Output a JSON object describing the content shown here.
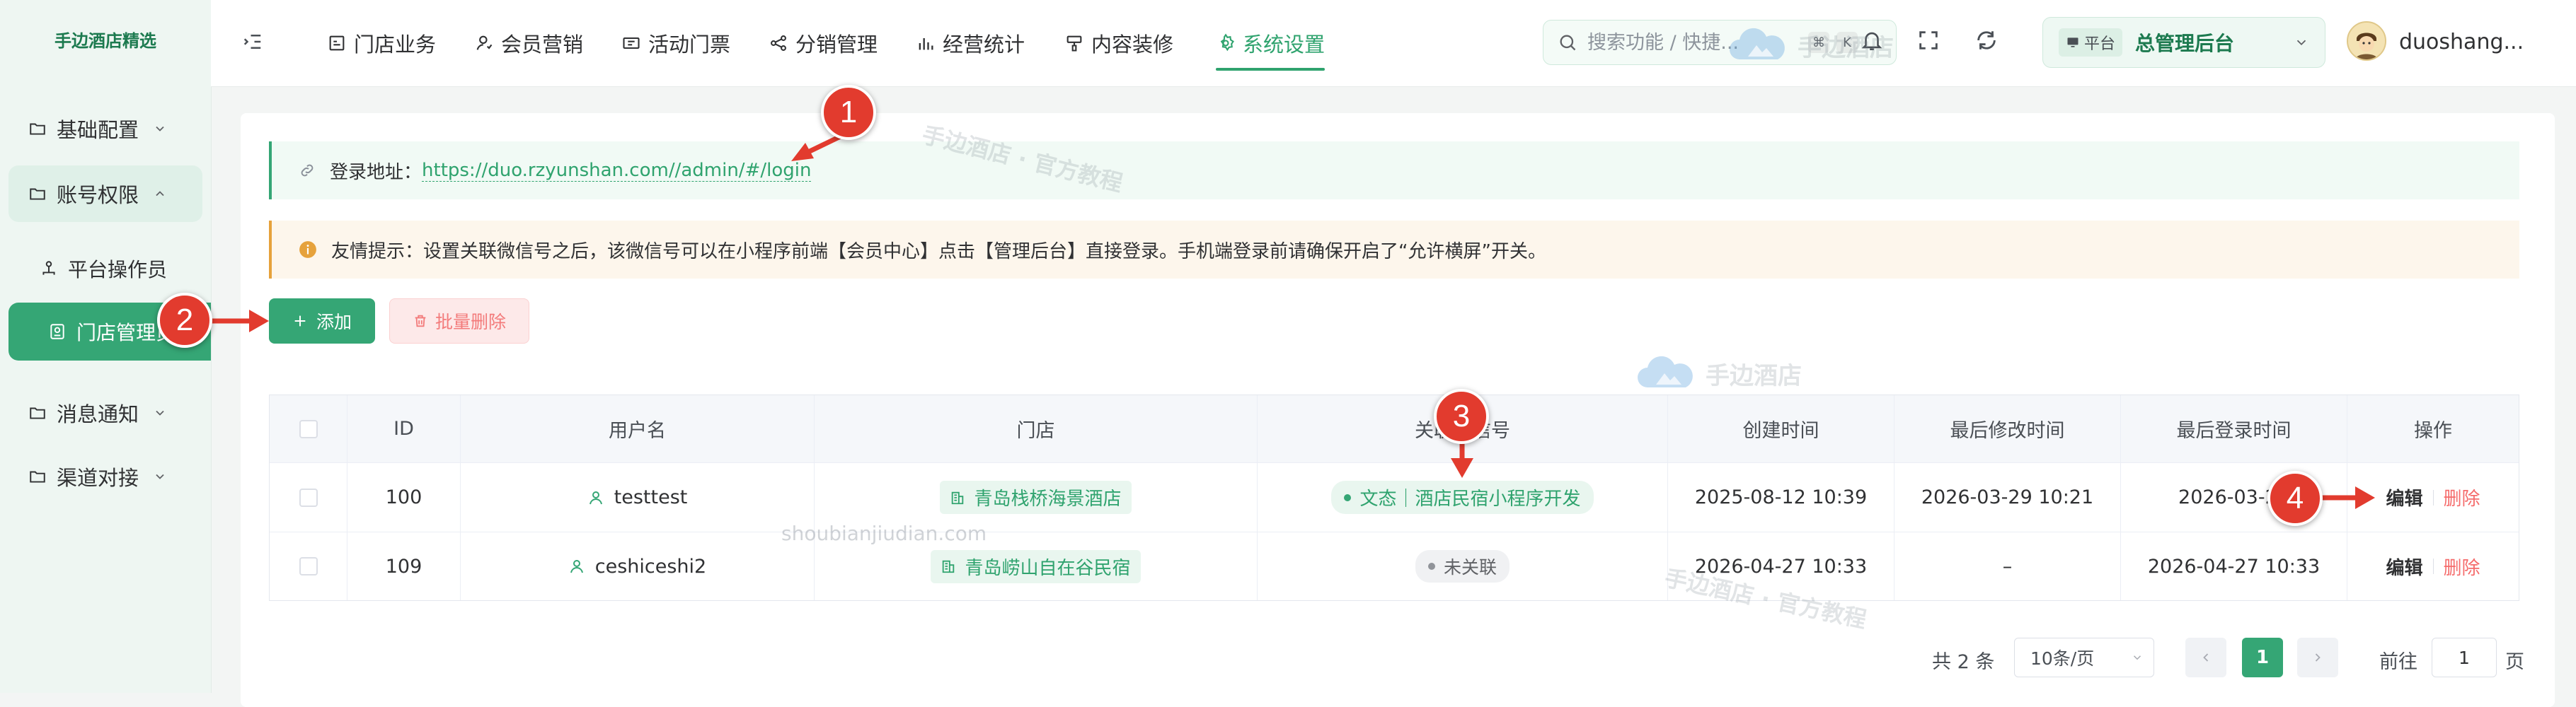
{
  "sidebar": {
    "brand": "手边酒店精选",
    "menu": [
      {
        "label": "基础配置"
      },
      {
        "label": "账号权限"
      },
      {
        "label": "消息通知"
      },
      {
        "label": "渠道对接"
      }
    ],
    "submenu": [
      {
        "label": "平台操作员"
      },
      {
        "label": "门店管理员"
      }
    ]
  },
  "topbar": {
    "tabs": [
      {
        "label": "门店业务",
        "icon": "store-icon"
      },
      {
        "label": "会员营销",
        "icon": "member-icon"
      },
      {
        "label": "活动门票",
        "icon": "ticket-icon"
      },
      {
        "label": "分销管理",
        "icon": "share-icon"
      },
      {
        "label": "经营统计",
        "icon": "bar-chart-icon"
      },
      {
        "label": "内容装修",
        "icon": "paint-icon"
      },
      {
        "label": "系统设置",
        "icon": "gear-icon",
        "active": true
      }
    ],
    "search_placeholder": "搜索功能 / 快捷...",
    "shortcut_keys": [
      "⌘",
      "K"
    ],
    "platform_tag": "平台",
    "platform_name": "总管理后台",
    "username": "duoshang..."
  },
  "alerts": {
    "login_label": "登录地址：",
    "login_url": "https://duo.rzyunshan.com//admin/#/login",
    "tip": "友情提示：设置关联微信号之后，该微信号可以在小程序前端【会员中心】点击【管理后台】直接登录。手机端登录前请确保开启了“允许横屏”开关。"
  },
  "toolbar": {
    "add_label": "添加",
    "batch_delete_label": "批量删除"
  },
  "table": {
    "headers": [
      "ID",
      "用户名",
      "门店",
      "关联微信号",
      "创建时间",
      "最后修改时间",
      "最后登录时间",
      "操作"
    ],
    "rows": [
      {
        "id": "100",
        "username": "testtest",
        "store": "青岛栈桥海景酒店",
        "wechat": "文态｜酒店民宿小程序开发",
        "wechat_linked": true,
        "created": "2025-08-12 10:39",
        "modified": "2026-03-29 10:21",
        "last_login": "2026-03-29",
        "edit": "编辑",
        "delete": "删除"
      },
      {
        "id": "109",
        "username": "ceshiceshi2",
        "store": "青岛崂山自在谷民宿",
        "wechat": "未关联",
        "wechat_linked": false,
        "created": "2026-04-27 10:33",
        "modified": "–",
        "last_login": "2026-04-27 10:33",
        "edit": "编辑",
        "delete": "删除"
      }
    ]
  },
  "pagination": {
    "total": "共 2 条",
    "page_size": "10条/页",
    "current": "1",
    "goto_label": "前往",
    "goto_value": "1",
    "goto_unit": "页"
  },
  "annotations": {
    "markers": [
      "1",
      "2",
      "3",
      "4"
    ],
    "color": "#e23b2e"
  },
  "watermarks": {
    "brand": "手边酒店",
    "tutorial": "手边酒店 · 官方教程",
    "domain": "shoubianjiudian.com"
  },
  "colors": {
    "accent": "#35a675",
    "danger": "#f56c6c",
    "warning": "#e6a23c"
  }
}
